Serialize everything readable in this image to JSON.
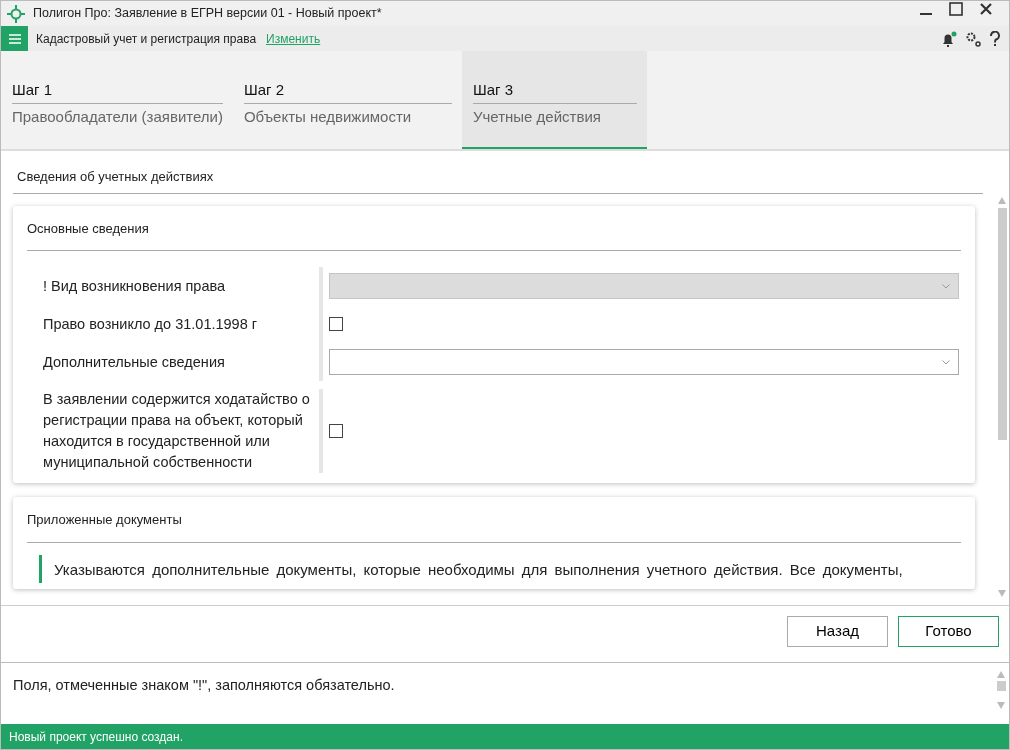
{
  "window": {
    "title": "Полигон Про: Заявление в ЕГРН версии 01 - Новый проект*"
  },
  "toolbar": {
    "mode": "Кадастровый учет и регистрация права",
    "change_link": "Изменить",
    "notification_unread": true
  },
  "steps": [
    {
      "step": "Шаг 1",
      "label": "Правообладатели (заявители)",
      "selected": false
    },
    {
      "step": "Шаг 2",
      "label": "Объекты недвижимости",
      "selected": false
    },
    {
      "step": "Шаг 3",
      "label": "Учетные действия",
      "selected": true
    }
  ],
  "section_title": "Сведения об учетных действиях",
  "main_card": {
    "title": "Основные сведения",
    "fields": [
      {
        "kind": "select",
        "label": "! Вид возникновения права",
        "disabled": true
      },
      {
        "kind": "checkbox",
        "label": "Право возникло до 31.01.1998 г",
        "checked": false
      },
      {
        "kind": "select",
        "label": "Дополнительные сведения",
        "disabled": false
      },
      {
        "kind": "checkbox",
        "label": "В заявлении содержится ходатайство о регистрации права на объект, который находится в государственной или муниципальной собственности",
        "checked": false
      }
    ]
  },
  "documents_card": {
    "title": "Приложенные документы",
    "note": "Указываются дополнительные документы, которые необходимы для выполнения учетного действия. Все документы,"
  },
  "buttons": [
    {
      "label": "Назад",
      "primary": false
    },
    {
      "label": "Готово",
      "primary": true
    }
  ],
  "message": "Поля, отмеченные знаком \"!\", заполняются обязательно.",
  "status_bar": "Новый проект успешно создан."
}
